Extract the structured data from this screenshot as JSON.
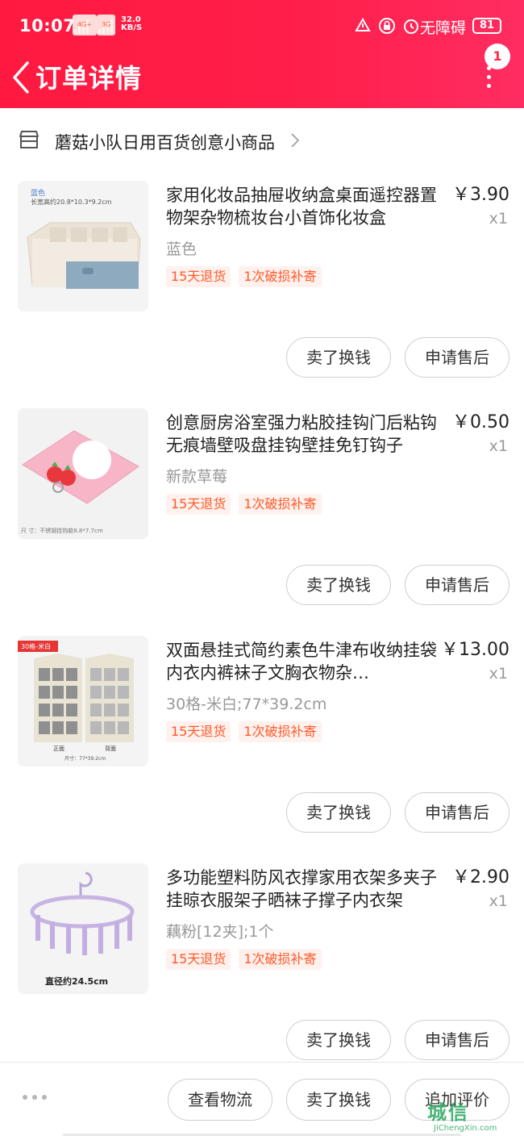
{
  "status_bar": {
    "time": "10:07",
    "net1": "4G+",
    "net2": "3G",
    "speed_value": "32.0",
    "speed_unit": "KB/S",
    "accessibility": "无障碍",
    "battery": "81"
  },
  "header": {
    "title": "订单详情",
    "badge_count": "1"
  },
  "shop": {
    "name": "蘑菇小队日用百货创意小商品"
  },
  "items": [
    {
      "title": "家用化妆品抽屉收纳盒桌面遥控器置物架杂物梳妆台小首饰化妆盒",
      "price": "￥3.90",
      "qty": "x1",
      "spec": "蓝色",
      "tags": [
        "15天退货",
        "1次破损补寄"
      ],
      "img_text1": "蓝色",
      "img_text2": "长宽高约20.8*10.3*9.2cm"
    },
    {
      "title": "创意厨房浴室强力粘胶挂钩门后粘钩无痕墙壁吸盘挂钩壁挂免钉钩子",
      "price": "￥0.50",
      "qty": "x1",
      "spec": "新款草莓",
      "tags": [
        "15天退货",
        "1次破损补寄"
      ],
      "img_text1": "尺 寸：不锈钢挂钩款8.8*7.7cm"
    },
    {
      "title": "双面悬挂式简约素色牛津布收纳挂袋内衣内裤袜子文胸衣物杂…",
      "price": "￥13.00",
      "qty": "x1",
      "spec": "30格-米白;77*39.2cm",
      "tags": [
        "15天退货",
        "1次破损补寄"
      ],
      "img_text1": "30格-米白",
      "img_text2": "正面",
      "img_text3": "背面",
      "img_text4": "尺寸：77*39.2cm"
    },
    {
      "title": "多功能塑料防风衣撑家用衣架多夹子挂晾衣服架子晒袜子撑子内衣架",
      "price": "￥2.90",
      "qty": "x1",
      "spec": "藕粉[12夹];1个",
      "tags": [
        "15天退货",
        "1次破损补寄"
      ],
      "img_text1": "直径约24.5cm"
    }
  ],
  "item_actions": {
    "sell": "卖了换钱",
    "after_sale": "申请售后"
  },
  "bottom_bar": {
    "logistics": "查看物流",
    "sell": "卖了换钱",
    "review": "追加评价"
  },
  "watermark": {
    "main": "城信",
    "sub": "JiChengXin.com"
  },
  "colors": {
    "header_red": "#ff1f4b",
    "tag_orange": "#ff5a2a",
    "tag_bg": "#fff1ed"
  }
}
